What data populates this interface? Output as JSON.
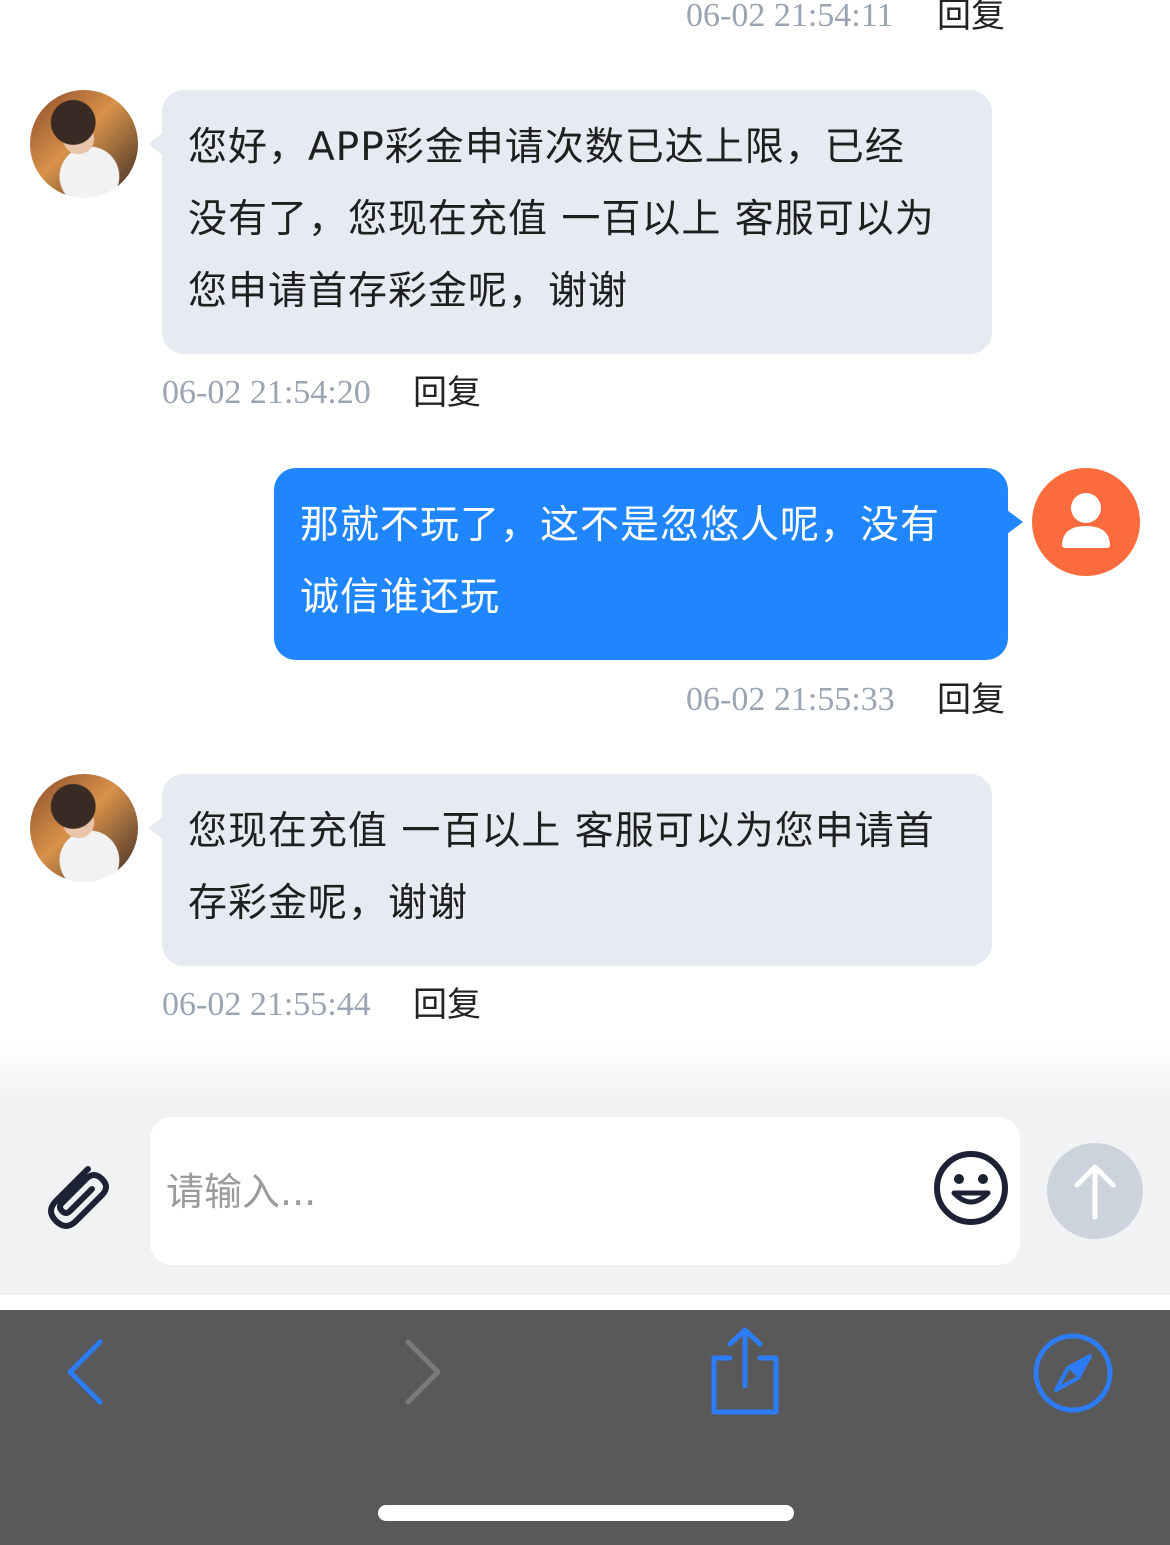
{
  "messages": [
    {
      "side": "out",
      "timestamp": "06-02 21:54:11",
      "reply_label": "回复"
    },
    {
      "side": "in",
      "lines": [
        "您好，APP彩金申请次数已达上限，已经",
        "没有了，您现在充值 一百以上 客服可以为",
        "您申请首存彩金呢，谢谢"
      ],
      "timestamp": "06-02 21:54:20",
      "reply_label": "回复"
    },
    {
      "side": "out",
      "lines": [
        "那就不玩了，这不是忽悠人呢，没有",
        "诚信谁还玩"
      ],
      "timestamp": "06-02 21:55:33",
      "reply_label": "回复"
    },
    {
      "side": "in",
      "lines": [
        "您现在充值 一百以上 客服可以为您申请首",
        "存彩金呢，谢谢"
      ],
      "timestamp": "06-02 21:55:44",
      "reply_label": "回复"
    }
  ],
  "composer": {
    "placeholder": "请输入..."
  },
  "icons": {
    "attach": "paperclip-icon",
    "emoji": "smiley-icon",
    "send": "arrow-up-icon",
    "back": "chevron-left-icon",
    "forward": "chevron-right-icon",
    "share": "share-icon",
    "browser": "compass-icon",
    "user": "user-avatar-icon"
  },
  "colors": {
    "outgoing_bubble": "#1f86ff",
    "incoming_bubble": "#e6eaf2",
    "user_avatar": "#fb6b3d",
    "toolbar": "#595959",
    "toolbar_icon": "#2d7cf6",
    "send_disabled": "#cdd3dc"
  }
}
